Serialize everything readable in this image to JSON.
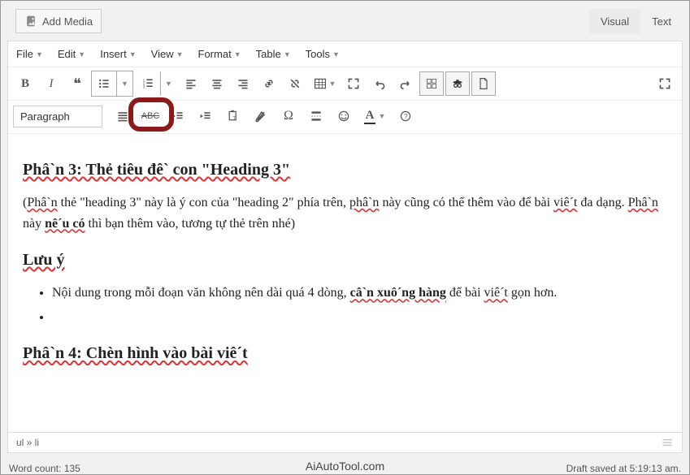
{
  "topbar": {
    "add_media": "Add Media",
    "tabs": {
      "visual": "Visual",
      "text": "Text"
    }
  },
  "menus": {
    "file": "File",
    "edit": "Edit",
    "insert": "Insert",
    "view": "View",
    "format": "Format",
    "table": "Table",
    "tools": "Tools"
  },
  "format_select": "Paragraph",
  "content": {
    "h3_1_a": "Phâ`n 3: Thẻ tiêu đê` con \"Heading 3\"",
    "p1_a": "(",
    "p1_b": "Phâ`n",
    "p1_c": " thẻ \"heading 3\" này là ý con của \"heading 2\" phía trên, ",
    "p1_d": "phâ`n",
    "p1_e": " này cũng có thể thêm vào để bài ",
    "p1_f": "viê´t",
    "p1_g": " đa dạng. ",
    "p1_h": "Phâ`n",
    "p1_i": " này ",
    "p1_j": "nê´u có",
    "p1_k": " thì bạn thêm vào, tương tự thẻ trên nhé)",
    "h3_2": "Lưu ý",
    "li1_a": "Nội dung trong mỗi đoạn văn không nên dài quá 4 dòng, ",
    "li1_b": "câ`n xuô´ng hàng",
    "li1_c": " để bài ",
    "li1_d": "viê´t",
    "li1_e": " gọn hơn.",
    "h3_3": "Phâ`n 4: Chèn hình vào bài viê´t"
  },
  "path": "ul » li",
  "status": {
    "wordcount_label": "Word count:",
    "wordcount": "135",
    "draft": "Draft saved at 5:19:13 am."
  },
  "watermark": "AiAutoTool.com"
}
